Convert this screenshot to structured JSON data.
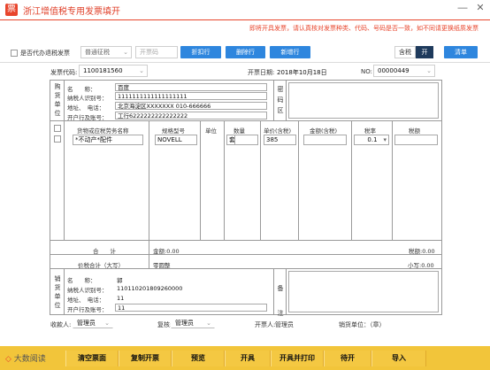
{
  "window": {
    "title": "浙江增值税专用发票填开",
    "minimize_glyph": "—",
    "close_glyph": "✕"
  },
  "notice": "即将开具发票，请认真核对发票种类、代码、号码是否一致，如不同请更换纸质发票",
  "toolbar": {
    "agent_checkbox_label": "是否代办退税发票",
    "levy_type": "普通征税",
    "invoice_number_placeholder": "开票码",
    "discount_row_label": "折扣行",
    "delete_row_label": "删除行",
    "add_row_label": "新增行",
    "tax_included_label": "含税",
    "tax_toggle_on": "开",
    "list_label": "清单"
  },
  "header": {
    "invoice_code_label": "发票代码:",
    "invoice_code": "1100181560",
    "date_label": "开票日期:",
    "date": "2018年10月18日",
    "no_label": "NO:",
    "no": "00000449"
  },
  "buyer": {
    "section_label": [
      "购",
      "货",
      "单",
      "位"
    ],
    "name_label": "名　　称：",
    "name": "百度",
    "tax_id_label": "纳税人识别号：",
    "tax_id": "1111111111111111111",
    "address_label": "地址、　电话：",
    "address": "北京海淀区XXXXXXX 010-666666",
    "bank_label": "开户行及账号：",
    "bank": "工行6222222222222222"
  },
  "password_area": {
    "labels": [
      "密",
      "码",
      "区"
    ]
  },
  "items_table": {
    "headers": [
      "货物或应税劳务名称",
      "规格型号",
      "单位",
      "数量",
      "单价(含税)",
      "金额(含税)",
      "税率",
      "税额"
    ],
    "row": {
      "name": "*不动产*配件",
      "spec": "NOVELL",
      "unit": "套",
      "quantity": "",
      "price": "385",
      "amount": "",
      "tax_rate": "0.1",
      "tax": ""
    }
  },
  "totals": {
    "total_label": "合　　计",
    "amount_label": "金额:0.00",
    "tax_label": "税额:0.00",
    "price_tax_label": "价税合计（大写）",
    "price_tax_upper": "零圆整",
    "price_tax_lower": "小写:0.00"
  },
  "seller": {
    "section_label": [
      "销",
      "货",
      "单",
      "位"
    ],
    "name_label": "名　　称：",
    "name": "郭",
    "tax_id_label": "纳税人识别号：",
    "tax_id": "110110201809260000",
    "address_label": "地址、　电话：",
    "address": "11",
    "bank_label": "开户行及账号：",
    "bank": "11"
  },
  "remarks": {
    "labels": [
      "备",
      "注"
    ]
  },
  "footer": {
    "payee_label": "收款人:",
    "payee": "管理员",
    "reviewer_label": "复核:",
    "reviewer": "管理员",
    "issuer_label": "开票人:",
    "issuer": "管理员",
    "seller_stamp": "销货单位：（章）"
  },
  "bottom_buttons": [
    "清空票面",
    "复制开票",
    "预览",
    "开具",
    "开具并打印",
    "待开",
    "导入"
  ],
  "brand": "大数阅读",
  "colors": {
    "accent": "#e8452c",
    "blue": "#2e86de",
    "bar": "#f2c53a"
  }
}
